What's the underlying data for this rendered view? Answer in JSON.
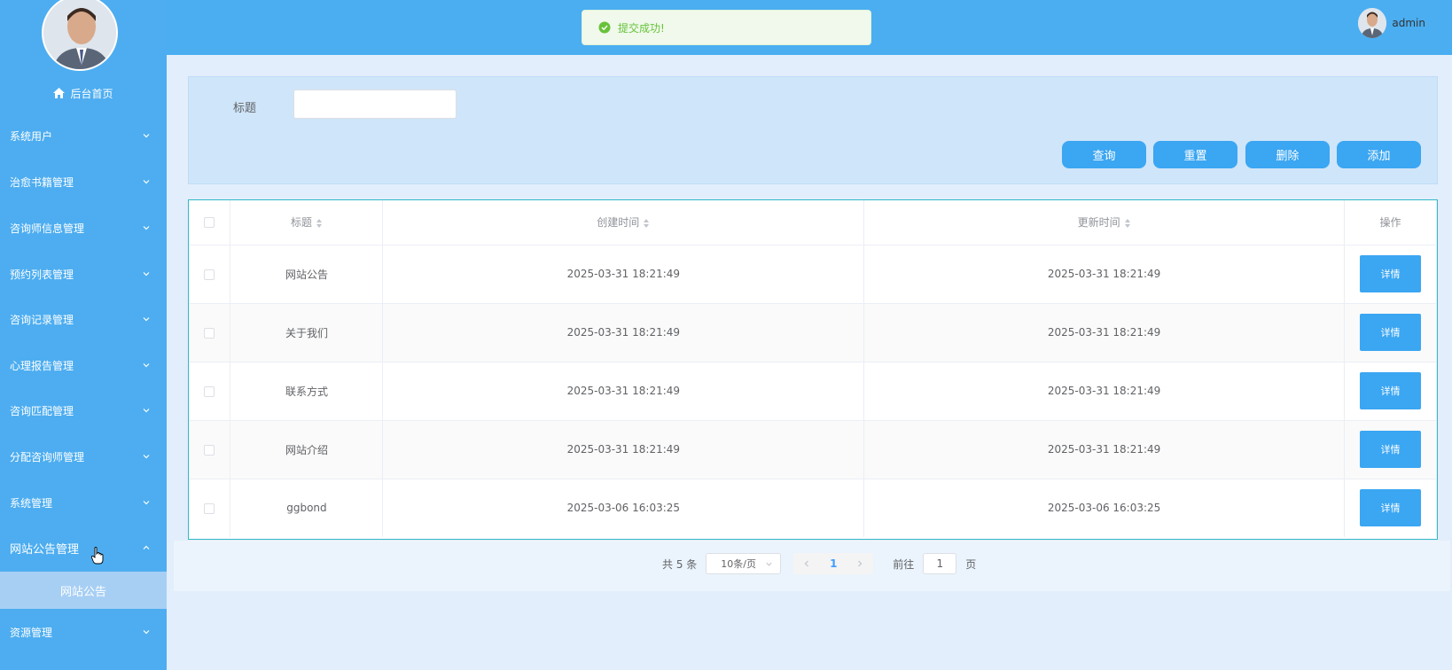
{
  "sidebar": {
    "home_label": "后台首页",
    "items": [
      {
        "label": "系统用户"
      },
      {
        "label": "治愈书籍管理"
      },
      {
        "label": "咨询师信息管理"
      },
      {
        "label": "预约列表管理"
      },
      {
        "label": "咨询记录管理"
      },
      {
        "label": "心理报告管理"
      },
      {
        "label": "咨询匹配管理"
      },
      {
        "label": "分配咨询师管理"
      },
      {
        "label": "系统管理"
      },
      {
        "label": "网站公告管理"
      },
      {
        "label": "资源管理"
      }
    ],
    "active_sub": "网站公告"
  },
  "header": {
    "toast": "提交成功!",
    "username": "admin"
  },
  "search": {
    "label": "标题",
    "value": ""
  },
  "toolbar": {
    "query": "查询",
    "reset": "重置",
    "delete": "删除",
    "add": "添加"
  },
  "table": {
    "columns": {
      "title": "标题",
      "created": "创建时间",
      "updated": "更新时间",
      "action": "操作"
    },
    "rows": [
      {
        "title": "网站公告",
        "created": "2025-03-31 18:21:49",
        "updated": "2025-03-31 18:21:49",
        "action": "详情"
      },
      {
        "title": "关于我们",
        "created": "2025-03-31 18:21:49",
        "updated": "2025-03-31 18:21:49",
        "action": "详情"
      },
      {
        "title": "联系方式",
        "created": "2025-03-31 18:21:49",
        "updated": "2025-03-31 18:21:49",
        "action": "详情"
      },
      {
        "title": "网站介绍",
        "created": "2025-03-31 18:21:49",
        "updated": "2025-03-31 18:21:49",
        "action": "详情"
      },
      {
        "title": "ggbond",
        "created": "2025-03-06 16:03:25",
        "updated": "2025-03-06 16:03:25",
        "action": "详情"
      }
    ]
  },
  "pagination": {
    "total": "共 5 条",
    "page_size": "10条/页",
    "current": "1",
    "goto_prefix": "前往",
    "goto_value": "1",
    "goto_suffix": "页"
  }
}
